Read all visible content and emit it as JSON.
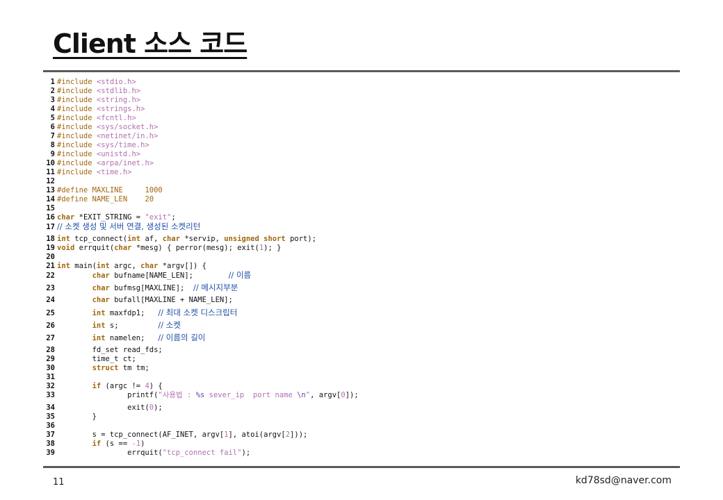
{
  "slide": {
    "title": "Client 소스 코드",
    "page_number": "11",
    "email": "kd78sd@naver.com"
  },
  "code": {
    "lines": [
      {
        "n": "1",
        "tokens": [
          [
            "#include ",
            "pp"
          ],
          [
            "<stdio.h>",
            "str"
          ]
        ]
      },
      {
        "n": "2",
        "tokens": [
          [
            "#include ",
            "pp"
          ],
          [
            "<stdlib.h>",
            "str"
          ]
        ]
      },
      {
        "n": "3",
        "tokens": [
          [
            "#include ",
            "pp"
          ],
          [
            "<string.h>",
            "str"
          ]
        ]
      },
      {
        "n": "4",
        "tokens": [
          [
            "#include ",
            "pp"
          ],
          [
            "<strings.h>",
            "str"
          ]
        ]
      },
      {
        "n": "5",
        "tokens": [
          [
            "#include ",
            "pp"
          ],
          [
            "<fcntl.h>",
            "str"
          ]
        ]
      },
      {
        "n": "6",
        "tokens": [
          [
            "#include ",
            "pp"
          ],
          [
            "<sys/socket.h>",
            "str"
          ]
        ]
      },
      {
        "n": "7",
        "tokens": [
          [
            "#include ",
            "pp"
          ],
          [
            "<netinet/in.h>",
            "str"
          ]
        ]
      },
      {
        "n": "8",
        "tokens": [
          [
            "#include ",
            "pp"
          ],
          [
            "<sys/time.h>",
            "str"
          ]
        ]
      },
      {
        "n": "9",
        "tokens": [
          [
            "#include ",
            "pp"
          ],
          [
            "<unistd.h>",
            "str"
          ]
        ]
      },
      {
        "n": "10",
        "tokens": [
          [
            "#include ",
            "pp"
          ],
          [
            "<arpa/inet.h>",
            "str"
          ]
        ]
      },
      {
        "n": "11",
        "tokens": [
          [
            "#include ",
            "pp"
          ],
          [
            "<time.h>",
            "str"
          ]
        ]
      },
      {
        "n": "12",
        "tokens": []
      },
      {
        "n": "13",
        "tokens": [
          [
            "#define MAXLINE     ",
            "pp"
          ],
          [
            "1000",
            "pp"
          ]
        ]
      },
      {
        "n": "14",
        "tokens": [
          [
            "#define NAME_LEN    ",
            "pp"
          ],
          [
            "20",
            "pp"
          ]
        ]
      },
      {
        "n": "15",
        "tokens": []
      },
      {
        "n": "16",
        "tokens": [
          [
            "char",
            "kw"
          ],
          [
            " *EXIT_STRING = ",
            "t"
          ],
          [
            "\"exit\"",
            "str"
          ],
          [
            ";",
            "t"
          ]
        ]
      },
      {
        "n": "17",
        "tokens": [
          [
            "// 소켓 생성 및 서버 연결, 생성된 소켓리턴",
            "cm"
          ]
        ]
      },
      {
        "n": "18",
        "tokens": [
          [
            "int",
            "kw"
          ],
          [
            " tcp_connect(",
            "t"
          ],
          [
            "int",
            "kw"
          ],
          [
            " af, ",
            "t"
          ],
          [
            "char",
            "kw"
          ],
          [
            " *servip, ",
            "t"
          ],
          [
            "unsigned short",
            "kw"
          ],
          [
            " port);",
            "t"
          ]
        ]
      },
      {
        "n": "19",
        "tokens": [
          [
            "void",
            "kw"
          ],
          [
            " errquit(",
            "t"
          ],
          [
            "char",
            "kw"
          ],
          [
            " *mesg) { perror(mesg); exit(",
            "t"
          ],
          [
            "1",
            "num"
          ],
          [
            "); }",
            "t"
          ]
        ]
      },
      {
        "n": "20",
        "tokens": []
      },
      {
        "n": "21",
        "tokens": [
          [
            "int",
            "kw"
          ],
          [
            " main(",
            "t"
          ],
          [
            "int",
            "kw"
          ],
          [
            " argc, ",
            "t"
          ],
          [
            "char",
            "kw"
          ],
          [
            " *argv[]) {",
            "t"
          ]
        ]
      },
      {
        "n": "22",
        "tokens": [
          [
            "        ",
            "t"
          ],
          [
            "char",
            "kw"
          ],
          [
            " bufname[NAME_LEN];        ",
            "t"
          ],
          [
            "// 이름",
            "cm"
          ]
        ]
      },
      {
        "n": "23",
        "tokens": [
          [
            "        ",
            "t"
          ],
          [
            "char",
            "kw"
          ],
          [
            " bufmsg[MAXLINE];  ",
            "t"
          ],
          [
            "// 메시지부분",
            "cm"
          ]
        ]
      },
      {
        "n": "24",
        "tokens": [
          [
            "        ",
            "t"
          ],
          [
            "char",
            "kw"
          ],
          [
            " bufall[MAXLINE + NAME_LEN];",
            "t"
          ]
        ]
      },
      {
        "n": "25",
        "tokens": [
          [
            "        ",
            "t"
          ],
          [
            "int",
            "kw"
          ],
          [
            " maxfdp1;   ",
            "t"
          ],
          [
            "// 최대 소켓 디스크립터",
            "cm"
          ]
        ]
      },
      {
        "n": "26",
        "tokens": [
          [
            "        ",
            "t"
          ],
          [
            "int",
            "kw"
          ],
          [
            " s;         ",
            "t"
          ],
          [
            "// 소켓",
            "cm"
          ]
        ]
      },
      {
        "n": "27",
        "tokens": [
          [
            "        ",
            "t"
          ],
          [
            "int",
            "kw"
          ],
          [
            " namelen;   ",
            "t"
          ],
          [
            "// 이름의 길이",
            "cm"
          ]
        ]
      },
      {
        "n": "28",
        "tokens": [
          [
            "        fd_set read_fds;",
            "t"
          ]
        ]
      },
      {
        "n": "29",
        "tokens": [
          [
            "        time_t ct;",
            "t"
          ]
        ]
      },
      {
        "n": "30",
        "tokens": [
          [
            "        ",
            "t"
          ],
          [
            "struct",
            "kw"
          ],
          [
            " tm tm;",
            "t"
          ]
        ]
      },
      {
        "n": "31",
        "tokens": []
      },
      {
        "n": "32",
        "tokens": [
          [
            "        ",
            "t"
          ],
          [
            "if",
            "kw"
          ],
          [
            " (argc != ",
            "t"
          ],
          [
            "4",
            "num"
          ],
          [
            ") {",
            "t"
          ]
        ]
      },
      {
        "n": "33",
        "tokens": [
          [
            "                printf(",
            "t"
          ],
          [
            "\"사용법 : ",
            "str"
          ],
          [
            "%s",
            "fmt"
          ],
          [
            " sever_ip  port name ",
            "str"
          ],
          [
            "\\n",
            "fmt"
          ],
          [
            "\"",
            "str"
          ],
          [
            ", argv[",
            "t"
          ],
          [
            "0",
            "num"
          ],
          [
            "]);",
            "t"
          ]
        ]
      },
      {
        "n": "34",
        "tokens": [
          [
            "                exit(",
            "t"
          ],
          [
            "0",
            "num"
          ],
          [
            ");",
            "t"
          ]
        ]
      },
      {
        "n": "35",
        "tokens": [
          [
            "        }",
            "t"
          ]
        ]
      },
      {
        "n": "36",
        "tokens": []
      },
      {
        "n": "37",
        "tokens": [
          [
            "        s = tcp_connect(AF_INET, argv[",
            "t"
          ],
          [
            "1",
            "num"
          ],
          [
            "], atoi(argv[",
            "t"
          ],
          [
            "2",
            "num"
          ],
          [
            "]));",
            "t"
          ]
        ]
      },
      {
        "n": "38",
        "tokens": [
          [
            "        ",
            "t"
          ],
          [
            "if",
            "kw"
          ],
          [
            " (s == ",
            "t"
          ],
          [
            "-1",
            "num"
          ],
          [
            ")",
            "t"
          ]
        ]
      },
      {
        "n": "39",
        "tokens": [
          [
            "                errquit(",
            "t"
          ],
          [
            "\"tcp_connect fail\"",
            "str"
          ],
          [
            ");",
            "t"
          ]
        ]
      }
    ]
  }
}
